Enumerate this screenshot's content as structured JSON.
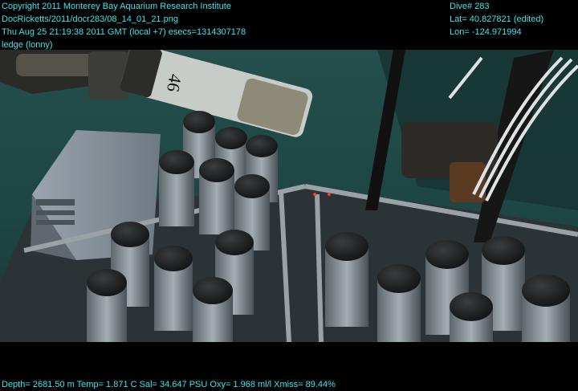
{
  "overlay": {
    "copyright": "Copyright 2011 Monterey Bay Aquarium Research Institute",
    "image_path": "DocRicketts/2011/docr283/08_14_01_21.png",
    "timestamp": "Thu Aug 25 21:19:38 2011 GMT (local +7)  esecs=1314307178",
    "site": "ledge (lonny)",
    "dive": "Dive# 283",
    "lat": "Lat= 40.827821 (edited)",
    "lon": "Lon= -124.971994",
    "sensors": "Depth= 2681.50 m  Temp= 1.871 C  Sal= 34.647 PSU  Oxy= 1.968 ml/l  Xmiss= 89.44%"
  },
  "scene": {
    "tube_number": "46",
    "colors": {
      "water": "#1f4a47",
      "metal": "#6e7980",
      "tube_cap": "#1b1d1e",
      "overlay_text": "#39e6ee"
    }
  }
}
